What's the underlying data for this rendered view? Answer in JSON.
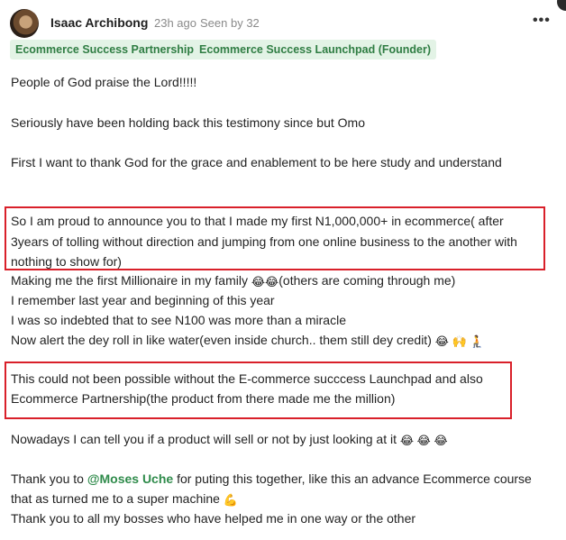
{
  "author": {
    "name": "Isaac Archibong",
    "time_ago": "23h ago",
    "seen_by": "Seen by 32"
  },
  "more_menu_glyph": "•••",
  "tags": [
    "Ecommerce Success Partnership",
    "Ecommerce Success Launchpad (Founder)"
  ],
  "body": {
    "l1": "People of God praise the Lord!!!!!",
    "l2": "Seriously have been holding back this testimony since but Omo",
    "l3": "First I want to thank God for the grace and enablement to be here study and understand",
    "h1a": "So I am proud to announce you to that I made my first N1,000,000+ in ecommerce( after",
    "h1b": "3years of tolling without direction and jumping from one online business to the another with",
    "h1c": "nothing to show for)",
    "l4_text": "Making me the first Millionaire in my family ",
    "l4_emoji": "😂😂",
    "l4_tail": "(others are coming through me)",
    "l5": "I remember last year and beginning of this year",
    "l6": "I was so indebted that to see N100 was more than a miracle",
    "l7_text": "Now alert the dey roll in like water(even inside church.. them still dey credit)",
    "l7_emoji": "😂 🙌 🧎",
    "h2a": "This could not been possible without the E-commerce succcess Launchpad and also",
    "h2b": "Ecommerce Partnership(the product from there made me the million)",
    "l8_text": "Nowadays I can tell you if a product will sell or not by just looking at it ",
    "l8_emoji": "😂 😂 😂",
    "l9_pre": "Thank you to ",
    "l9_mention": "@Moses Uche",
    "l9_post": " for puting this together, like this an advance Ecommerce course",
    "l10_text": "that as turned me to a super machine ",
    "l10_emoji": "💪",
    "l11": "Thank you to all my bosses who have helped me in one way or the other"
  },
  "highlight_color": "#d9202a",
  "tag_color": "#2f7d43",
  "mention_color": "#2f8b4b"
}
